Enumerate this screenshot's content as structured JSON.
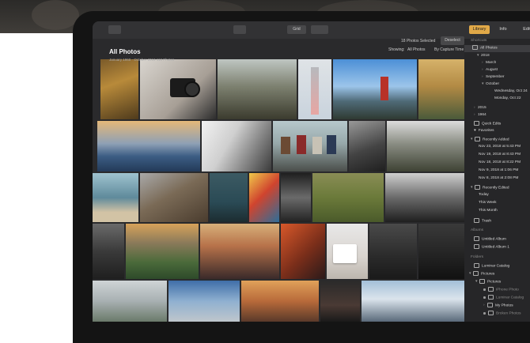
{
  "toolbar": {
    "view_label": "Grid",
    "selection_status": "18 Photos Selected",
    "deselect_label": "Deselect",
    "tabs": [
      "Library",
      "Info",
      "Edit"
    ]
  },
  "main": {
    "title": "All Photos",
    "subtitle": "January 1960 - October 2018     118 Photos",
    "showing_label": "Showing:",
    "showing_value": "All Photos",
    "sort_value": "By Capture Time"
  },
  "sidebar": {
    "shortcuts_header": "Shortcuts",
    "all_photos": "All Photos",
    "year_2018": "2018",
    "march": "March",
    "august": "August",
    "september": "September",
    "october": "October",
    "oct_24": "Wednesday, Oct 24",
    "oct_22": "Monday, Oct 22",
    "year_2015": "2015",
    "year_1964": "1964",
    "quick_edits": "Quick Edits",
    "favorites": "Favorites",
    "recently_added": "Recently Added",
    "recent_added_items": [
      "Nov 23, 2018 at 5:43 PM",
      "Nov 19, 2018 at 8:43 PM",
      "Nov 18, 2018 at 8:22 PM",
      "Nov 9, 2018 at 1:06 PM",
      "Nov 8, 2018 at 2:08 PM"
    ],
    "recently_edited": "Recently Edited",
    "today": "Today",
    "this_week": "This Week",
    "this_month": "This Month",
    "trash": "Trash",
    "albums_header": "Albums",
    "albums": [
      "Untitled Album",
      "Untitled Album 1"
    ],
    "folders_header": "Folders",
    "folders": [
      "Luminar Catalog",
      "Pictures",
      "Pictures",
      "iPhone Photo",
      "Luminar Catalog",
      "My Photos",
      "Broken Photos"
    ]
  },
  "colors": {
    "accent": "#e1a948",
    "panel": "#262628",
    "background": "#2a2a2c"
  }
}
